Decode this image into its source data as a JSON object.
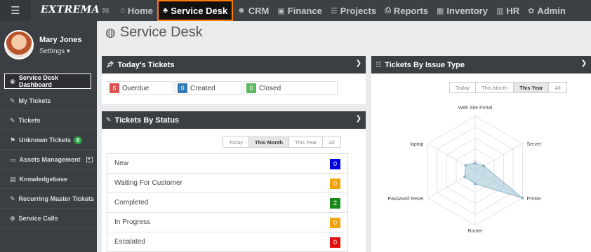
{
  "app": {
    "logo": "EXTREMA"
  },
  "nav": {
    "items": [
      {
        "label": "",
        "icon": "envelope-icon",
        "glyph": "✉"
      },
      {
        "label": "Home",
        "icon": "home-icon",
        "glyph": "⌂"
      },
      {
        "label": "Service Desk",
        "icon": "sitemap-icon",
        "glyph": "♣",
        "active": true
      },
      {
        "label": "CRM",
        "icon": "users-icon",
        "glyph": "☻"
      },
      {
        "label": "Finance",
        "icon": "money-icon",
        "glyph": "▣"
      },
      {
        "label": "Projects",
        "icon": "list-icon",
        "glyph": "☰"
      },
      {
        "label": "Reports",
        "icon": "print-icon",
        "glyph": "⎙"
      },
      {
        "label": "Inventory",
        "icon": "building-icon",
        "glyph": "▦"
      },
      {
        "label": "HR",
        "icon": "briefcase-icon",
        "glyph": "▥"
      },
      {
        "label": "Admin",
        "icon": "gear-icon",
        "glyph": "✿"
      }
    ]
  },
  "user": {
    "name": "Mary Jones",
    "settings": "Settings ▾"
  },
  "sidebar": {
    "items": [
      {
        "label": "Service Desk Dashboard",
        "icon": "dashboard-icon",
        "glyph": "◉",
        "active": true
      },
      {
        "label": "My Tickets",
        "icon": "ticket-icon",
        "glyph": "✎"
      },
      {
        "label": "Tickets",
        "icon": "ticket-icon",
        "glyph": "✎"
      },
      {
        "label": "Unknown Tickets",
        "icon": "flag-icon",
        "glyph": "⚑",
        "badge": "0"
      },
      {
        "label": "Assets Management",
        "icon": "laptop-icon",
        "glyph": "▭",
        "caret": "▾"
      },
      {
        "label": "Knowledgebase",
        "icon": "book-icon",
        "glyph": "▤"
      },
      {
        "label": "Recurring Master Tickets",
        "icon": "ticket-icon",
        "glyph": "✎"
      },
      {
        "label": "Service Calls",
        "icon": "lifesaver-icon",
        "glyph": "⊕"
      }
    ]
  },
  "page": {
    "title": "Service Desk"
  },
  "todays_tickets": {
    "title": "Today's Tickets",
    "items": [
      {
        "count": "6",
        "label": "Overdue",
        "color": "#d9534f"
      },
      {
        "count": "0",
        "label": "Created",
        "color": "#337ab7"
      },
      {
        "count": "0",
        "label": "Closed",
        "color": "#5cb85c"
      }
    ]
  },
  "tickets_by_status": {
    "title": "Tickets By Status",
    "filters": [
      "Today",
      "This Month",
      "This Year",
      "All"
    ],
    "active_filter": "This Month",
    "rows": [
      {
        "label": "New",
        "count": "0",
        "color": "#0000e0"
      },
      {
        "label": "Waiting For Customer",
        "count": "0",
        "color": "#f0a30a"
      },
      {
        "label": "Completed",
        "count": "2",
        "color": "#1a8a1a"
      },
      {
        "label": "In Progress",
        "count": "0",
        "color": "#f0a30a"
      },
      {
        "label": "Escalated",
        "count": "0",
        "color": "#e01010"
      }
    ]
  },
  "tickets_by_issue": {
    "title": "Tickets By Issue Type",
    "filters": [
      "Today",
      "This Month",
      "This Year",
      "All"
    ],
    "active_filter": "This Year"
  },
  "chart_data": {
    "type": "radar",
    "categories": [
      "Web Site Portal",
      "Server",
      "Printer",
      "Router",
      "Password Reset",
      "laptop"
    ],
    "values": [
      0.7,
      0.9,
      5,
      1.2,
      1.1,
      1.0
    ],
    "max": 5,
    "rings": 5,
    "fill_color": "#9ec3d6",
    "stroke_color": "#8fb4c8"
  }
}
